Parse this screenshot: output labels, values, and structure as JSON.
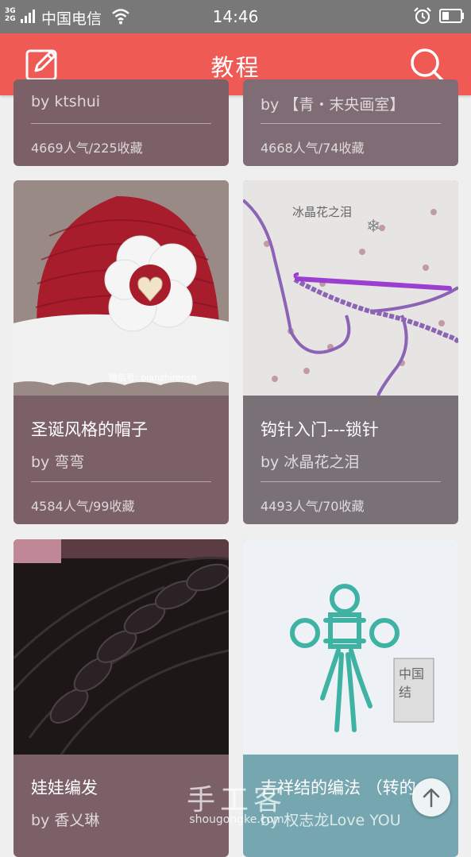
{
  "status_bar": {
    "network_top": "3G",
    "network_bottom": "2G",
    "carrier": "中国电信",
    "time": "14:46"
  },
  "header": {
    "title": "教程"
  },
  "cards": [
    {
      "author": "by ktshui",
      "stats": "4669人气/225收藏"
    },
    {
      "author": "by 【青・末央画室】",
      "stats": "4668人气/74收藏"
    },
    {
      "title": "圣诞风格的帽子",
      "author": "by 弯弯",
      "stats": "4584人气/99收藏",
      "image_caption": "微信号: bianzhirensh"
    },
    {
      "title": "钩针入门---锁针",
      "author": "by 冰晶花之泪",
      "stats": "4493人气/70收藏",
      "image_caption": "冰晶花之泪"
    },
    {
      "title": "娃娃编发",
      "author": "by 香乂琳"
    },
    {
      "title": "吉祥结的编法 （转的",
      "author": "by 权志龙Love YOU"
    }
  ],
  "watermark": {
    "main": "手工客",
    "sub": "shougongke.com"
  },
  "icons": {
    "edit": "pencil-square-icon",
    "search": "search-icon",
    "scroll_top": "arrow-up-icon",
    "alarm": "alarm-icon",
    "battery": "battery-icon",
    "wifi": "wifi-icon",
    "signal": "signal-icon"
  },
  "colors": {
    "header": "#f05a55",
    "status_bar": "#787878",
    "card_mauve": "#7c6068",
    "card_grey": "#7a7177",
    "card_teal": "#76a7b0",
    "background": "#f0efef"
  }
}
